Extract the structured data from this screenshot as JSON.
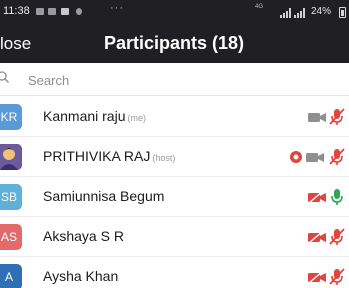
{
  "status_bar": {
    "time": "11:38",
    "overflow_dots": "···",
    "network": "4G",
    "battery": "24%"
  },
  "header": {
    "close_label": "lose",
    "title": "Participants (18)"
  },
  "search": {
    "placeholder": "Search"
  },
  "participants": [
    {
      "initials": "KR",
      "avatar_color": "#5b9bd5",
      "name": "Kanmani raju",
      "tag": "(me)",
      "video": "off-gray",
      "audio": "muted",
      "recording": false
    },
    {
      "initials": "",
      "avatar_color": "#6a5a9e",
      "name": "PRITHIVIKA RAJ",
      "tag": "(host)",
      "video": "off-gray",
      "audio": "muted",
      "recording": true
    },
    {
      "initials": "SB",
      "avatar_color": "#5fb1d8",
      "name": "Samiunnisa Begum",
      "tag": "",
      "video": "off-red",
      "audio": "unmuted",
      "recording": false
    },
    {
      "initials": "AS",
      "avatar_color": "#e36a6a",
      "name": "Akshaya S R",
      "tag": "",
      "video": "off-red",
      "audio": "muted",
      "recording": false
    },
    {
      "initials": "A",
      "avatar_color": "#2f6fb5",
      "name": "Aysha Khan",
      "tag": "",
      "video": "off-red",
      "audio": "muted",
      "recording": false
    }
  ],
  "colors": {
    "header_bg": "#1f1f24",
    "muted_red": "#e0463d",
    "video_gray": "#8e8e93",
    "unmuted_green": "#2fa84f"
  }
}
